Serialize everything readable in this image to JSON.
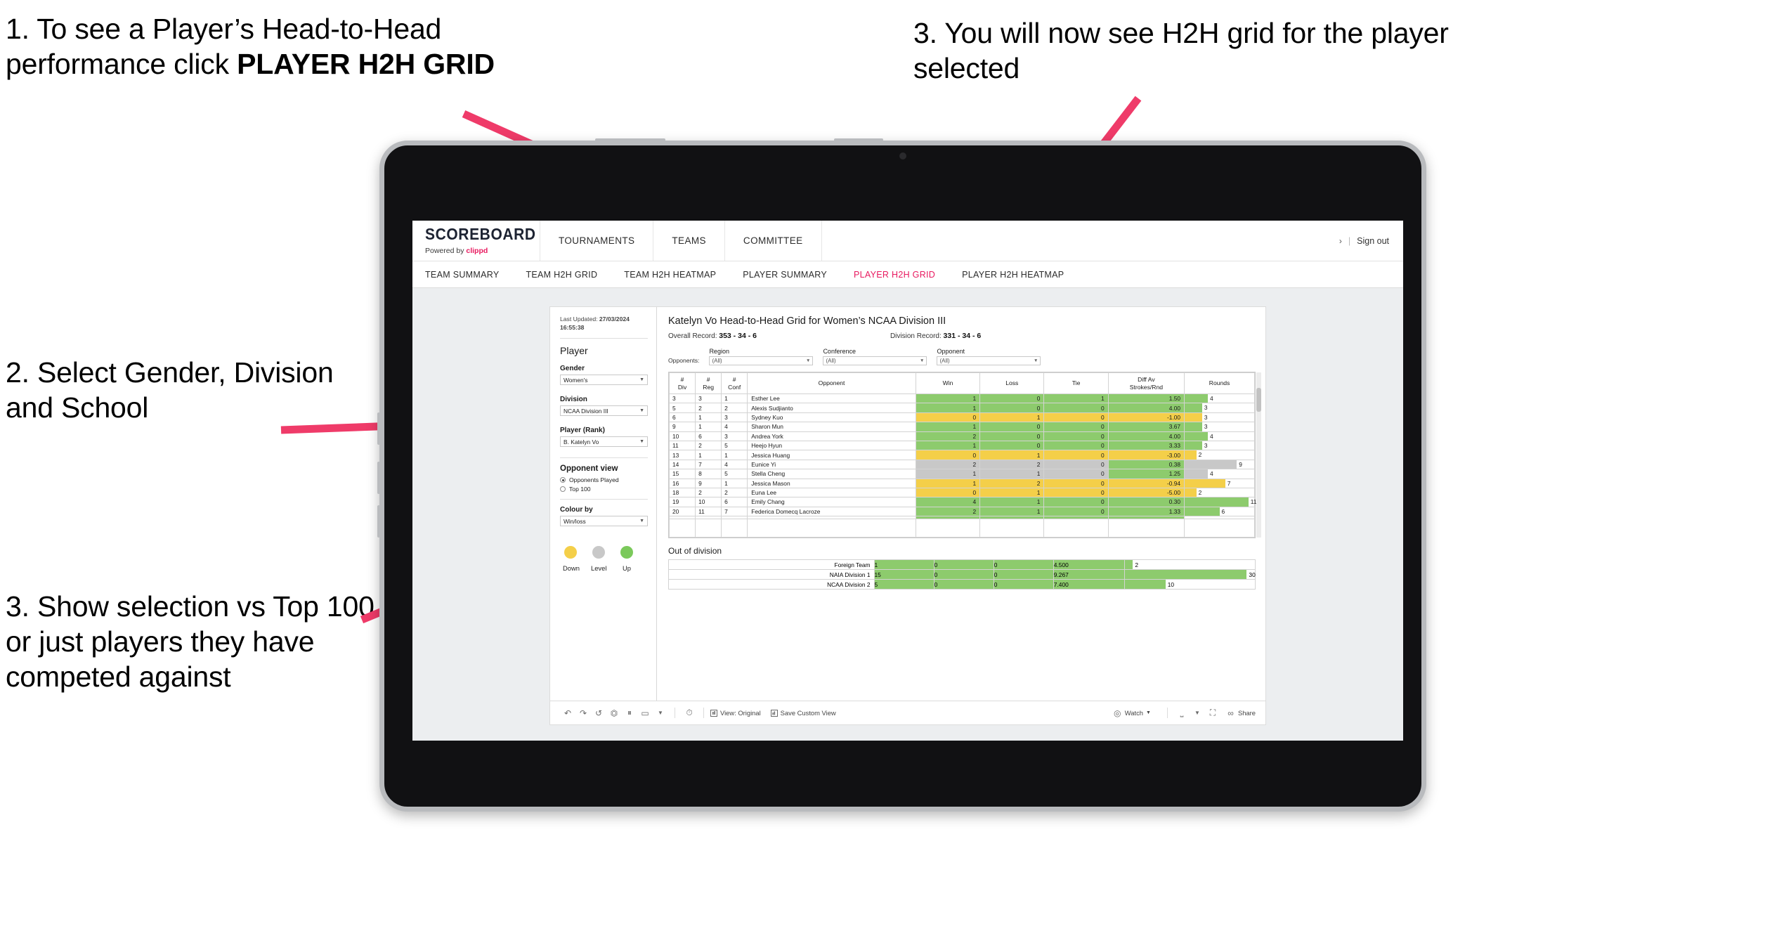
{
  "annotations": [
    {
      "id": "annot-1",
      "prefix": "1. To see a Player’s Head-to-Head performance click ",
      "strong": "PLAYER H2H GRID"
    },
    {
      "id": "annot-2",
      "text": "2. Select Gender, Division and School"
    },
    {
      "id": "annot-3",
      "text": "3. Show selection vs Top 100 or just players they have competed against"
    },
    {
      "id": "annot-4",
      "text": "3. You will now see H2H grid for the player selected"
    }
  ],
  "app": {
    "brand": {
      "title": "SCOREBOARD",
      "powered_prefix": "Powered by ",
      "powered_brand": "clippd"
    },
    "top_nav": [
      "TOURNAMENTS",
      "TEAMS",
      "COMMITTEE"
    ],
    "account": {
      "chevron": "›",
      "separator": "|",
      "sign_out": "Sign out"
    },
    "sub_nav": [
      {
        "label": "TEAM SUMMARY",
        "active": false
      },
      {
        "label": "TEAM H2H GRID",
        "active": false
      },
      {
        "label": "TEAM H2H HEATMAP",
        "active": false
      },
      {
        "label": "PLAYER SUMMARY",
        "active": false
      },
      {
        "label": "PLAYER H2H GRID",
        "active": true
      },
      {
        "label": "PLAYER H2H HEATMAP",
        "active": false
      }
    ]
  },
  "filters": {
    "last_updated_label": "Last Updated: ",
    "last_updated_value": "27/03/2024 16:55:38",
    "section_title": "Player",
    "gender": {
      "label": "Gender",
      "value": "Women's"
    },
    "division": {
      "label": "Division",
      "value": "NCAA Division III"
    },
    "player_rank": {
      "label": "Player (Rank)",
      "value": "B. Katelyn Vo"
    },
    "opponent_view": {
      "title": "Opponent view",
      "options": [
        {
          "label": "Opponents Played",
          "selected": true
        },
        {
          "label": "Top 100",
          "selected": false
        }
      ]
    },
    "colour_by": {
      "label": "Colour by",
      "value": "Win/loss"
    },
    "legend": [
      {
        "label": "Down",
        "color": "#f4cf49"
      },
      {
        "label": "Level",
        "color": "#c8c8c8"
      },
      {
        "label": "Up",
        "color": "#7bc95b"
      }
    ]
  },
  "view": {
    "title": "Katelyn Vo Head-to-Head Grid for Women’s NCAA Division III",
    "overall_record_label": "Overall Record: ",
    "overall_record_value": "353 -  34 - 6",
    "division_record_label": "Division Record: ",
    "division_record_value": "331 -  34 - 6",
    "opponents_label": "Opponents:",
    "opponent_filters": [
      {
        "caption": "Region",
        "value": "(All)"
      },
      {
        "caption": "Conference",
        "value": "(All)"
      },
      {
        "caption": "Opponent",
        "value": "(All)"
      }
    ]
  },
  "chart_data": {
    "type": "table",
    "title": "Katelyn Vo Head-to-Head Grid for Women’s NCAA Division III",
    "columns": [
      "# Div",
      "# Reg",
      "# Conf",
      "Opponent",
      "Win",
      "Loss",
      "Tie",
      "Diff Av Strokes/Rnd",
      "Rounds"
    ],
    "column_lines": [
      [
        "#",
        "Div"
      ],
      [
        "#",
        "Reg"
      ],
      [
        "#",
        "Conf"
      ],
      [
        "Opponent"
      ],
      [
        "Win"
      ],
      [
        "Loss"
      ],
      [
        "Tie"
      ],
      [
        "Diff Av",
        "Strokes/Rnd"
      ],
      [
        "Rounds"
      ]
    ],
    "rounds_max": 12,
    "rows": [
      {
        "div": "3",
        "reg": "3",
        "conf": "1",
        "opponent": "Esther Lee",
        "win": "1",
        "loss": "0",
        "tie": "1",
        "diff": "1.50",
        "rounds": "4",
        "color": "green"
      },
      {
        "div": "5",
        "reg": "2",
        "conf": "2",
        "opponent": "Alexis Sudjianto",
        "win": "1",
        "loss": "0",
        "tie": "0",
        "diff": "4.00",
        "rounds": "3",
        "color": "green"
      },
      {
        "div": "6",
        "reg": "1",
        "conf": "3",
        "opponent": "Sydney Kuo",
        "win": "0",
        "loss": "1",
        "tie": "0",
        "diff": "-1.00",
        "rounds": "3",
        "color": "yellow"
      },
      {
        "div": "9",
        "reg": "1",
        "conf": "4",
        "opponent": "Sharon Mun",
        "win": "1",
        "loss": "0",
        "tie": "0",
        "diff": "3.67",
        "rounds": "3",
        "color": "green"
      },
      {
        "div": "10",
        "reg": "6",
        "conf": "3",
        "opponent": "Andrea York",
        "win": "2",
        "loss": "0",
        "tie": "0",
        "diff": "4.00",
        "rounds": "4",
        "color": "green"
      },
      {
        "div": "11",
        "reg": "2",
        "conf": "5",
        "opponent": "Heejo Hyun",
        "win": "1",
        "loss": "0",
        "tie": "0",
        "diff": "3.33",
        "rounds": "3",
        "color": "green"
      },
      {
        "div": "13",
        "reg": "1",
        "conf": "1",
        "opponent": "Jessica Huang",
        "win": "0",
        "loss": "1",
        "tie": "0",
        "diff": "-3.00",
        "rounds": "2",
        "color": "yellow"
      },
      {
        "div": "14",
        "reg": "7",
        "conf": "4",
        "opponent": "Eunice Yi",
        "win": "2",
        "loss": "2",
        "tie": "0",
        "diff": "0.38",
        "rounds": "9",
        "color": "grey",
        "diff_color": "green"
      },
      {
        "div": "15",
        "reg": "8",
        "conf": "5",
        "opponent": "Stella Cheng",
        "win": "1",
        "loss": "1",
        "tie": "0",
        "diff": "1.25",
        "rounds": "4",
        "color": "grey",
        "diff_color": "green"
      },
      {
        "div": "16",
        "reg": "9",
        "conf": "1",
        "opponent": "Jessica Mason",
        "win": "1",
        "loss": "2",
        "tie": "0",
        "diff": "-0.94",
        "rounds": "7",
        "color": "yellow"
      },
      {
        "div": "18",
        "reg": "2",
        "conf": "2",
        "opponent": "Euna Lee",
        "win": "0",
        "loss": "1",
        "tie": "0",
        "diff": "-5.00",
        "rounds": "2",
        "color": "yellow"
      },
      {
        "div": "19",
        "reg": "10",
        "conf": "6",
        "opponent": "Emily Chang",
        "win": "4",
        "loss": "1",
        "tie": "0",
        "diff": "0.30",
        "rounds": "11",
        "color": "green"
      },
      {
        "div": "20",
        "reg": "11",
        "conf": "7",
        "opponent": "Federica Domecq Lacroze",
        "win": "2",
        "loss": "1",
        "tie": "0",
        "diff": "1.33",
        "rounds": "6",
        "color": "green"
      }
    ],
    "out_of_division": {
      "title": "Out of division",
      "rows": [
        {
          "label": "Foreign Team",
          "win": "1",
          "loss": "0",
          "tie": "0",
          "diff": "4.500",
          "rounds": "2",
          "color": "green"
        },
        {
          "label": "NAIA Division 1",
          "win": "15",
          "loss": "0",
          "tie": "0",
          "diff": "9.267",
          "rounds": "30",
          "color": "green"
        },
        {
          "label": "NCAA Division 2",
          "win": "5",
          "loss": "0",
          "tie": "0",
          "diff": "7.400",
          "rounds": "10",
          "color": "green"
        }
      ],
      "rounds_max": 32
    }
  },
  "toolbar": {
    "view_label": "View: Original",
    "save_label": "Save Custom View",
    "watch_label": "Watch",
    "share_label": "Share"
  },
  "colors": {
    "accent_pink": "#e8195f",
    "green": "#8dcb6d",
    "yellow": "#f4cf49",
    "grey": "#c8c8c8"
  }
}
